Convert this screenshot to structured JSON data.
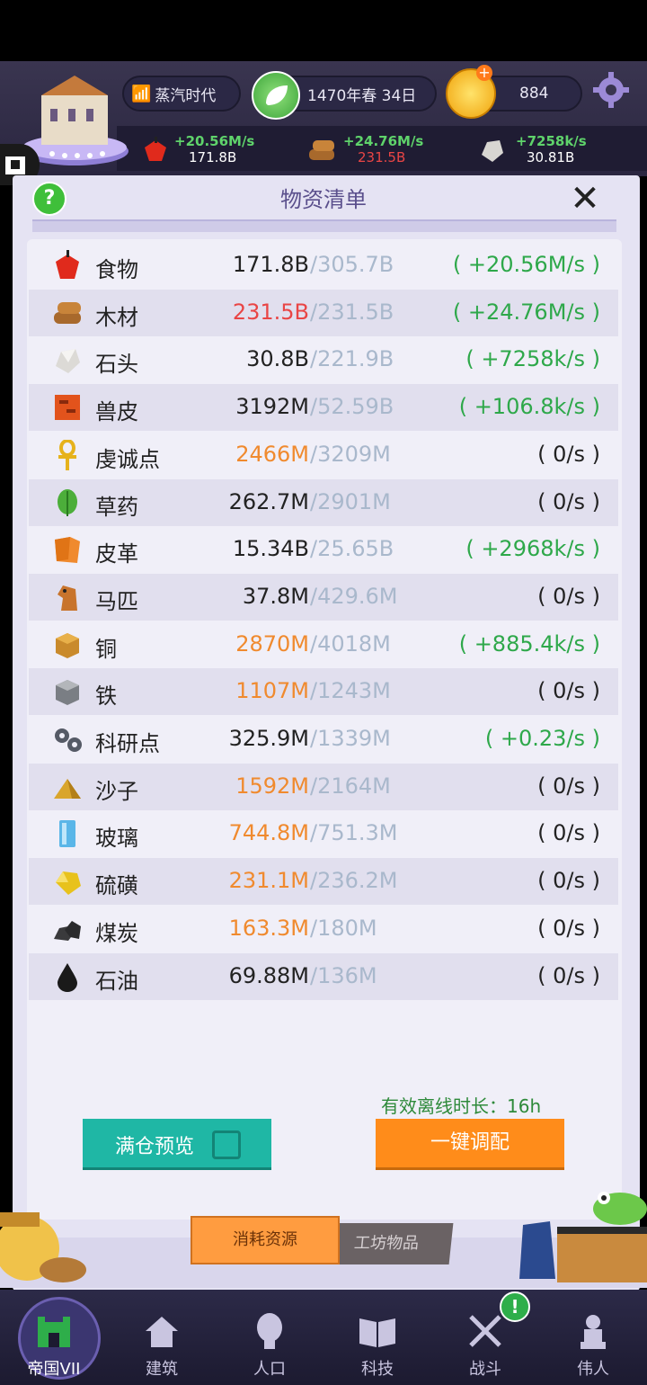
{
  "header": {
    "era": "蒸汽时代",
    "date": "1470年春 34日",
    "gold": "884"
  },
  "resource_bar": [
    {
      "rate": "+20.56M/s",
      "amount": "171.8B",
      "amount_color": "#ffffff"
    },
    {
      "rate": "+24.76M/s",
      "amount": "231.5B",
      "amount_color": "#e94545"
    },
    {
      "rate": "+7258k/s",
      "amount": "30.81B",
      "amount_color": "#ffffff"
    }
  ],
  "panel": {
    "title": "物资清单",
    "help": "?",
    "close": "✕"
  },
  "resources": [
    {
      "name": "食物",
      "current": "171.8B",
      "max": "/305.7B",
      "rate": "( +20.56M/s )",
      "cur_class": "black",
      "rate_class": "green",
      "icon": "apple-icon"
    },
    {
      "name": "木材",
      "current": "231.5B",
      "max": "/231.5B",
      "rate": "( +24.76M/s )",
      "cur_class": "red",
      "rate_class": "green",
      "icon": "wood-icon"
    },
    {
      "name": "石头",
      "current": "30.8B",
      "max": "/221.9B",
      "rate": "( +7258k/s )",
      "cur_class": "black",
      "rate_class": "green",
      "icon": "stone-icon"
    },
    {
      "name": "兽皮",
      "current": "3192M",
      "max": "/52.59B",
      "rate": "( +106.8k/s )",
      "cur_class": "black",
      "rate_class": "green",
      "icon": "hide-icon"
    },
    {
      "name": "虔诚点",
      "current": "2466M",
      "max": "/3209M",
      "rate": "( 0/s )",
      "cur_class": "orange",
      "rate_class": "black",
      "icon": "ankh-icon"
    },
    {
      "name": "草药",
      "current": "262.7M",
      "max": "/2901M",
      "rate": "( 0/s )",
      "cur_class": "black",
      "rate_class": "black",
      "icon": "herb-icon"
    },
    {
      "name": "皮革",
      "current": "15.34B",
      "max": "/25.65B",
      "rate": "( +2968k/s )",
      "cur_class": "black",
      "rate_class": "green",
      "icon": "leather-icon"
    },
    {
      "name": "马匹",
      "current": "37.8M",
      "max": "/429.6M",
      "rate": "( 0/s )",
      "cur_class": "black",
      "rate_class": "black",
      "icon": "horse-icon"
    },
    {
      "name": "铜",
      "current": "2870M",
      "max": "/4018M",
      "rate": "( +885.4k/s )",
      "cur_class": "orange",
      "rate_class": "green",
      "icon": "copper-icon"
    },
    {
      "name": "铁",
      "current": "1107M",
      "max": "/1243M",
      "rate": "( 0/s )",
      "cur_class": "orange",
      "rate_class": "black",
      "icon": "iron-icon"
    },
    {
      "name": "科研点",
      "current": "325.9M",
      "max": "/1339M",
      "rate": "( +0.23/s )",
      "cur_class": "black",
      "rate_class": "green",
      "icon": "gears-icon"
    },
    {
      "name": "沙子",
      "current": "1592M",
      "max": "/2164M",
      "rate": "( 0/s )",
      "cur_class": "orange",
      "rate_class": "black",
      "icon": "sand-icon"
    },
    {
      "name": "玻璃",
      "current": "744.8M",
      "max": "/751.3M",
      "rate": "( 0/s )",
      "cur_class": "orange",
      "rate_class": "black",
      "icon": "glass-icon"
    },
    {
      "name": "硫磺",
      "current": "231.1M",
      "max": "/236.2M",
      "rate": "( 0/s )",
      "cur_class": "orange",
      "rate_class": "black",
      "icon": "sulfur-icon"
    },
    {
      "name": "煤炭",
      "current": "163.3M",
      "max": "/180M",
      "rate": "( 0/s )",
      "cur_class": "orange",
      "rate_class": "black",
      "icon": "coal-icon"
    },
    {
      "name": "石油",
      "current": "69.88M",
      "max": "/136M",
      "rate": "( 0/s )",
      "cur_class": "black",
      "rate_class": "black",
      "icon": "oil-icon"
    }
  ],
  "offline": "有效离线时长：16h",
  "buttons": {
    "preview": "满仓预览",
    "allocate": "一键调配"
  },
  "tabs": {
    "consume": "消耗资源",
    "workshop": "工坊物品"
  },
  "nav": [
    {
      "label": "帝国VII",
      "icon": "castle-icon"
    },
    {
      "label": "建筑",
      "icon": "house-icon"
    },
    {
      "label": "人口",
      "icon": "person-icon"
    },
    {
      "label": "科技",
      "icon": "book-icon"
    },
    {
      "label": "战斗",
      "icon": "swords-icon"
    },
    {
      "label": "伟人",
      "icon": "statue-icon"
    }
  ],
  "colors": {
    "green": "#2ea84a",
    "orange": "#f08a2e",
    "red": "#e94545",
    "teal": "#1fb7a5",
    "button_orange": "#ff8c1a"
  }
}
